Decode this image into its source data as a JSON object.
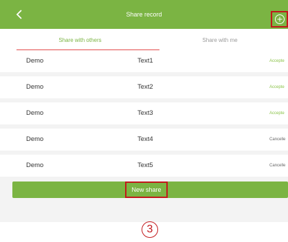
{
  "header": {
    "title": "Share record",
    "back_icon": "chevron-left-icon",
    "add_icon": "plus-circle-icon",
    "color": "#7bb443"
  },
  "tabs": [
    {
      "label": "Share with others",
      "active": true
    },
    {
      "label": "Share with me",
      "active": false
    }
  ],
  "records": [
    {
      "name": "Demo",
      "text": "Text1",
      "status": "Accepte"
    },
    {
      "name": "Demo",
      "text": "Text2",
      "status": "Accepte"
    },
    {
      "name": "Demo",
      "text": "Text3",
      "status": "Accepte"
    },
    {
      "name": "Demo",
      "text": "Text4",
      "status": "Cancelle"
    },
    {
      "name": "Demo",
      "text": "Text5",
      "status": "Cancelle"
    }
  ],
  "footer": {
    "new_share_label": "New share"
  },
  "step_marker": "3",
  "colors": {
    "accent": "#7bb443",
    "highlight": "#c2171b",
    "tab_underline": "#e24a4a",
    "accepted": "#8bc34a",
    "cancelled": "#666666"
  }
}
